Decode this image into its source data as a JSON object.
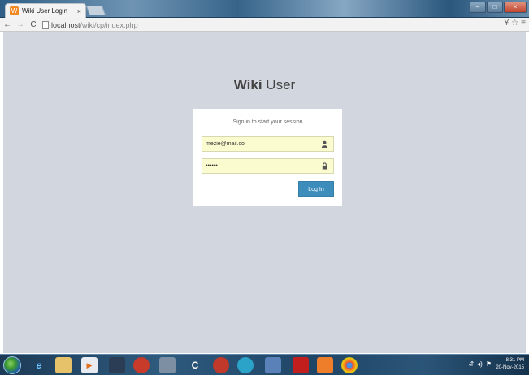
{
  "browser": {
    "tab_title": "Wiki User Login",
    "tab_close": "×",
    "favicon_glyph": "W",
    "url_host": "localhost",
    "url_path": "/wiki/cp/index.php"
  },
  "page": {
    "logo_bold": "Wiki",
    "logo_rest": " User",
    "login_msg": "Sign in to start your session",
    "email_value": "mezie@mail.co",
    "password_value": "••••••",
    "login_button": "Log In"
  },
  "taskbar": {
    "clock_time": "8:31 PM",
    "clock_date": "20-Nov-2015"
  },
  "colors": {
    "page_bg": "#d2d6de",
    "input_bg": "#fbfbd0",
    "button_bg": "#3c8dbc"
  },
  "icons": [
    "back-icon",
    "forward-icon",
    "reload-icon",
    "page-icon",
    "user-icon",
    "lock-icon",
    "star-icon",
    "menu-icon"
  ]
}
